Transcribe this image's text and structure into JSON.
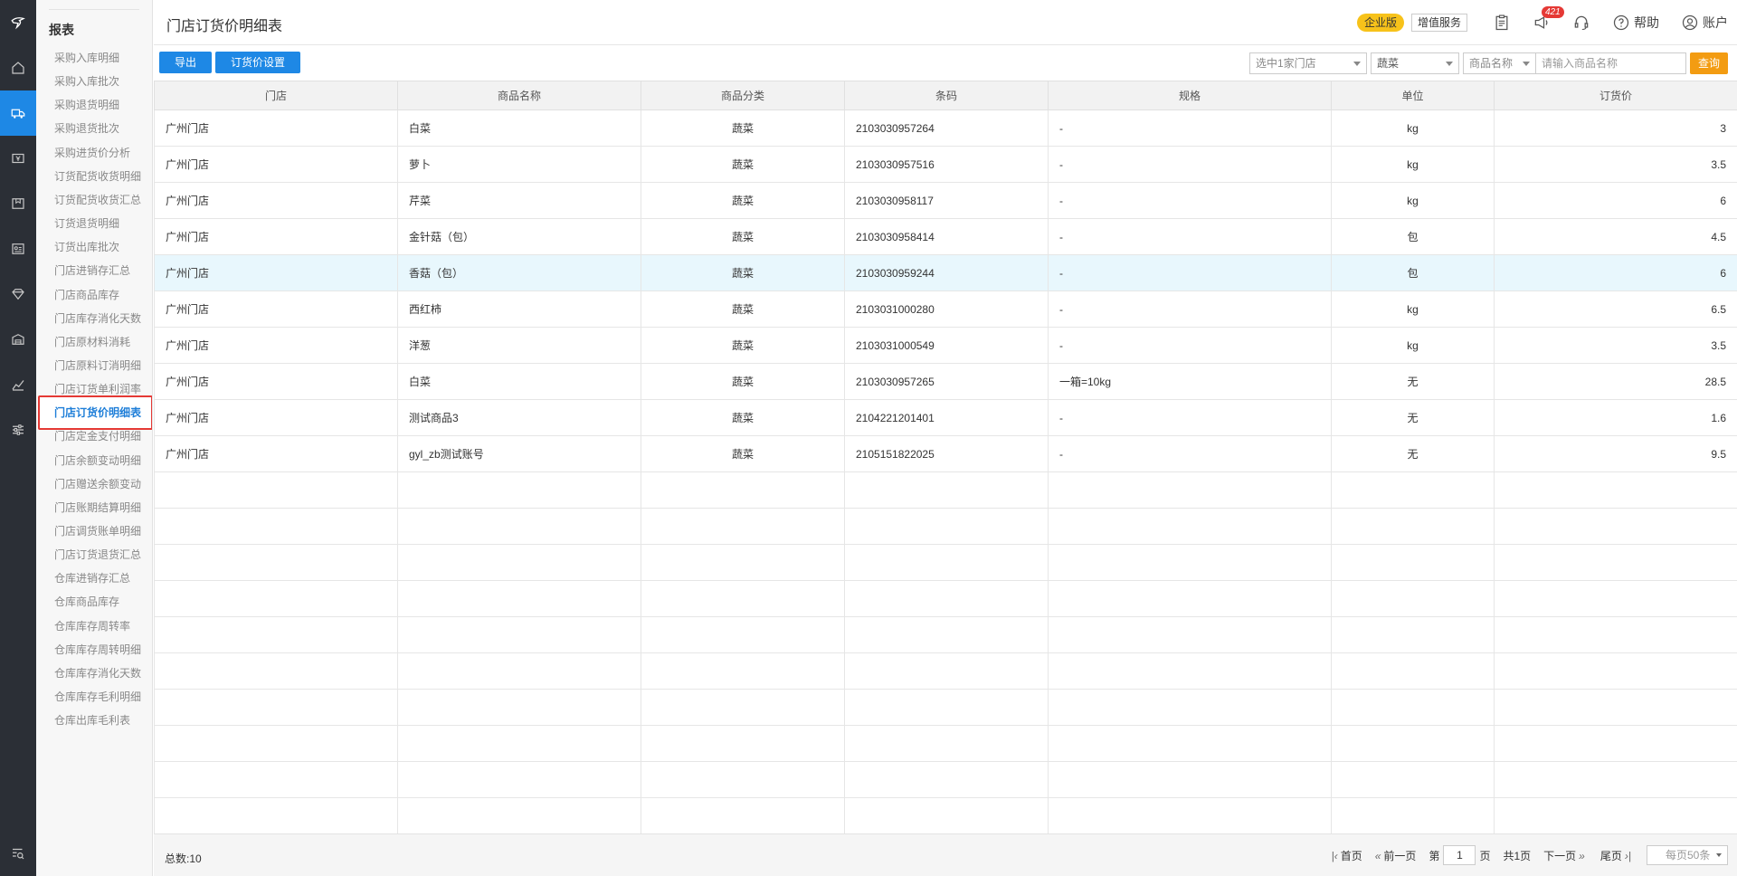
{
  "rail": {
    "icons": [
      "logo-icon",
      "home-icon",
      "truck-icon",
      "money-icon",
      "box-icon",
      "id-card-icon",
      "diamond-icon",
      "warehouse-icon",
      "chart-icon",
      "sliders-icon",
      "search-list-icon"
    ]
  },
  "submenu": {
    "title": "报表",
    "items": [
      "采购入库明细",
      "采购入库批次",
      "采购退货明细",
      "采购退货批次",
      "采购进货价分析",
      "订货配货收货明细",
      "订货配货收货汇总",
      "订货退货明细",
      "订货出库批次",
      "门店进销存汇总",
      "门店商品库存",
      "门店库存消化天数",
      "门店原材料消耗",
      "门店原料订消明细",
      "门店订货单利润率",
      "门店订货价明细表",
      "门店定金支付明细",
      "门店余额变动明细",
      "门店赠送余额变动",
      "门店账期结算明细",
      "门店调货账单明细",
      "门店订货退货汇总",
      "仓库进销存汇总",
      "仓库商品库存",
      "仓库库存周转率",
      "仓库库存周转明细",
      "仓库库存消化天数",
      "仓库库存毛利明细",
      "仓库出库毛利表"
    ],
    "active_index": 15
  },
  "header": {
    "title": "门店订货价明细表",
    "edition_badge": "企业版",
    "value_service": "增值服务",
    "notification_count": "421",
    "help_label": "帮助",
    "account_label": "账户"
  },
  "toolbar": {
    "export_label": "导出",
    "price_setting_label": "订货价设置",
    "store_select": "选中1家门店",
    "category_select": "蔬菜",
    "field_select": "商品名称",
    "search_placeholder": "请输入商品名称",
    "query_label": "查询"
  },
  "table": {
    "headers": [
      "门店",
      "商品名称",
      "商品分类",
      "条码",
      "规格",
      "单位",
      "订货价"
    ],
    "rows": [
      [
        "广州门店",
        "白菜",
        "蔬菜",
        "2103030957264",
        "-",
        "kg",
        "3"
      ],
      [
        "广州门店",
        "萝卜",
        "蔬菜",
        "2103030957516",
        "-",
        "kg",
        "3.5"
      ],
      [
        "广州门店",
        "芹菜",
        "蔬菜",
        "2103030958117",
        "-",
        "kg",
        "6"
      ],
      [
        "广州门店",
        "金针菇（包）",
        "蔬菜",
        "2103030958414",
        "-",
        "包",
        "4.5"
      ],
      [
        "广州门店",
        "香菇（包）",
        "蔬菜",
        "2103030959244",
        "-",
        "包",
        "6"
      ],
      [
        "广州门店",
        "西红柿",
        "蔬菜",
        "2103031000280",
        "-",
        "kg",
        "6.5"
      ],
      [
        "广州门店",
        "洋葱",
        "蔬菜",
        "2103031000549",
        "-",
        "kg",
        "3.5"
      ],
      [
        "广州门店",
        "白菜",
        "蔬菜",
        "2103030957265",
        "一箱=10kg",
        "无",
        "28.5"
      ],
      [
        "广州门店",
        "测试商品3",
        "蔬菜",
        "2104221201401",
        "-",
        "无",
        "1.6"
      ],
      [
        "广州门店",
        "gyl_zb测试账号",
        "蔬菜",
        "2105151822025",
        "-",
        "无",
        "9.5"
      ]
    ],
    "highlighted_row": 4,
    "empty_rows": 10
  },
  "footer": {
    "total": "总数:10",
    "first": "首页",
    "prev": "前一页",
    "page_prefix": "第",
    "page_value": "1",
    "page_suffix": "页",
    "total_pages": "共1页",
    "next": "下一页",
    "last": "尾页",
    "page_size": "每页50条"
  }
}
